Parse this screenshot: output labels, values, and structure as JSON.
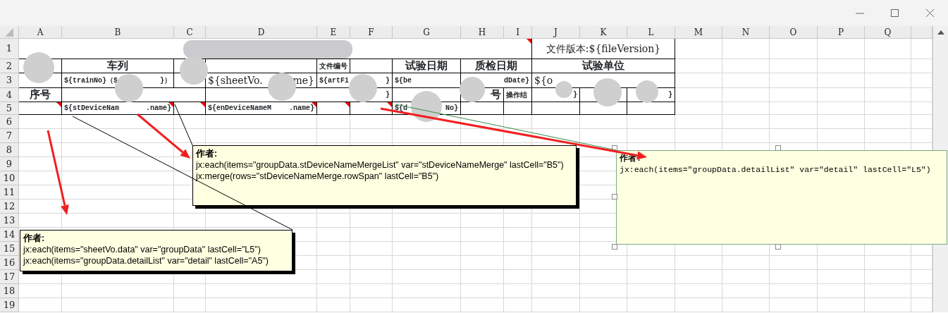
{
  "sheet": {
    "columns": [
      "A",
      "B",
      "C",
      "D",
      "E",
      "F",
      "G",
      "H",
      "I",
      "J",
      "K",
      "L",
      "M",
      "N",
      "O",
      "P",
      "Q"
    ],
    "rows": [
      {
        "number": "1",
        "cells": [
          {
            "colspan": 9,
            "comment": true
          },
          {
            "colspan": 3,
            "parts": [
              "文件版本:${fileVersion}"
            ],
            "kind": "template-large"
          }
        ]
      },
      {
        "number": "2",
        "cells": [
          {},
          {
            "parts": [
              "车列"
            ],
            "kind": "label-large"
          },
          {},
          {},
          {
            "parts": [
              "文件编号"
            ],
            "kind": "label-small"
          },
          {},
          {
            "parts": [
              "试验日期"
            ],
            "kind": "label-large"
          },
          {
            "colspan": 2,
            "parts": [
              "质检日期"
            ],
            "kind": "label-large"
          },
          {
            "colspan": 3,
            "parts": [
              "试验单位"
            ],
            "kind": "label-large"
          }
        ]
      },
      {
        "number": "3",
        "cells": [
          {},
          {
            "parts": [
              "${trainNo}（$",
              "}）"
            ],
            "kind": "template"
          },
          {},
          {
            "parts": [
              "${sheetVo.",
              "me}"
            ],
            "kind": "template-large"
          },
          {
            "colspan": 2,
            "parts": [
              "${artFi",
              "}"
            ],
            "kind": "template"
          },
          {
            "parts": [
              "${be"
            ],
            "kind": "template",
            "cut_end": true
          },
          {
            "colspan": 2,
            "parts": [
              "dDate}"
            ],
            "kind": "template",
            "cut_start": true
          },
          {
            "colspan": 3,
            "parts": [
              "${o"
            ],
            "kind": "template-large",
            "cut_end": true
          }
        ]
      },
      {
        "number": "4",
        "cells": [
          {
            "parts": [
              "序号"
            ],
            "kind": "label-large"
          },
          {
            "colspan": 2
          },
          {
            "colspan": 3,
            "parts": [
              "}"
            ],
            "kind": "template",
            "cut_start": true
          },
          {},
          {
            "parts": [
              "号"
            ],
            "kind": "label-large",
            "cut_start": true
          },
          {
            "parts": [
              "操作结"
            ],
            "kind": "label-small",
            "cut_end": true
          },
          {
            "parts": [
              "}"
            ],
            "kind": "template",
            "cut_start": true
          },
          {},
          {
            "parts": [
              "}"
            ],
            "kind": "template",
            "cut_start": true
          }
        ]
      },
      {
        "number": "5",
        "cells": [
          {
            "comment": true
          },
          {
            "parts": [
              "${stDeviceNam",
              ".name}"
            ],
            "kind": "template",
            "comment": true
          },
          {
            "comment": true
          },
          {
            "parts": [
              "${enDeviceNameM",
              ".name}"
            ],
            "kind": "template",
            "comment": true
          },
          {
            "comment": true
          },
          {
            "comment": true
          },
          {
            "parts": [
              "${d",
              "No}"
            ],
            "kind": "template"
          },
          {},
          {},
          {},
          {},
          {}
        ]
      },
      {
        "number": "6"
      },
      {
        "number": "7"
      },
      {
        "number": "8"
      },
      {
        "number": "9"
      },
      {
        "number": "10"
      },
      {
        "number": "11"
      },
      {
        "number": "12"
      },
      {
        "number": "13"
      },
      {
        "number": "14"
      },
      {
        "number": "15"
      },
      {
        "number": "16"
      },
      {
        "number": "17"
      },
      {
        "number": "18"
      },
      {
        "number": "19"
      }
    ]
  },
  "comments": [
    {
      "author": "作者:",
      "lines": [
        "jx:each(items=\"groupData.stDeviceNameMergeList\" var=\"stDeviceNameMerge\" lastCell=\"B5\")",
        "jx:merge(rows=\"stDeviceNameMerge.rowSpan\" lastCell=\"B5\")"
      ],
      "kind": "note",
      "selected": false
    },
    {
      "author": "作者:",
      "lines": [
        "jx:each(items=\"sheetVo.data\" var=\"groupData\" lastCell=\"L5\")",
        "jx:each(items=\"groupData.detailList\" var=\"detail\" lastCell=\"A5\")"
      ],
      "kind": "note",
      "selected": false
    },
    {
      "author": "作者:",
      "lines": [
        "jx:each(items=\"groupData.detailList\" var=\"detail\" lastCell=\"L5\")"
      ],
      "kind": "mono",
      "selected": true
    }
  ]
}
